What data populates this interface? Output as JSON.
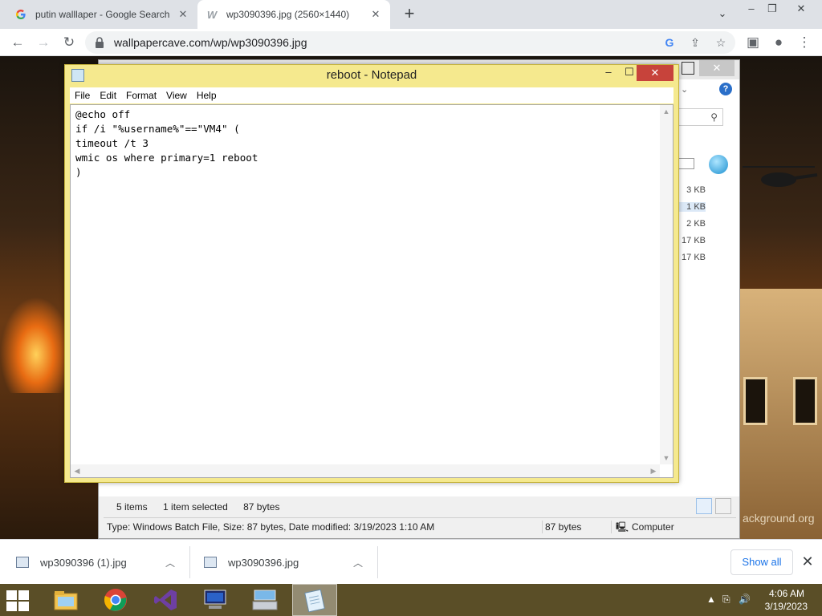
{
  "browser": {
    "tabs": [
      {
        "title": "putin walllaper - Google Search",
        "favicon": "google-g-icon"
      },
      {
        "title": "wp3090396.jpg (2560×1440)",
        "favicon": "wallpapercave-icon"
      }
    ],
    "url": "wallpapercave.com/wp/wp3090396.jpg"
  },
  "page": {
    "bg_caption": "ackground.org"
  },
  "explorer": {
    "file_sizes": [
      "3 KB",
      "1 KB",
      "2 KB",
      "17 KB",
      "17 KB"
    ],
    "item_count": "5 items",
    "selection": "1 item selected",
    "selection_size": "87 bytes",
    "details": "Type: Windows Batch File, Size: 87 bytes, Date modified: 3/19/2023 1:10 AM",
    "size_field": "87 bytes",
    "location": "Computer"
  },
  "notepad": {
    "title": "reboot - Notepad",
    "menu": [
      "File",
      "Edit",
      "Format",
      "View",
      "Help"
    ],
    "content": "@echo off\nif /i \"%username%\"==\"VM4\" (\ntimeout /t 3\nwmic os where primary=1 reboot\n)"
  },
  "downloads": {
    "items": [
      "wp3090396 (1).jpg",
      "wp3090396.jpg"
    ],
    "show_all": "Show all"
  },
  "taskbar": {
    "time": "4:06 AM",
    "date": "3/19/2023",
    "apps": [
      "file-explorer-icon",
      "chrome-icon",
      "visual-studio-icon",
      "remote-desktop-icon",
      "on-screen-keyboard-icon",
      "notepad-icon"
    ]
  },
  "colors": {
    "notepad_frame": "#f5e98e",
    "close_red": "#c7433b",
    "chrome_tabstrip": "#dee1e6",
    "link_blue": "#1a73e8"
  }
}
